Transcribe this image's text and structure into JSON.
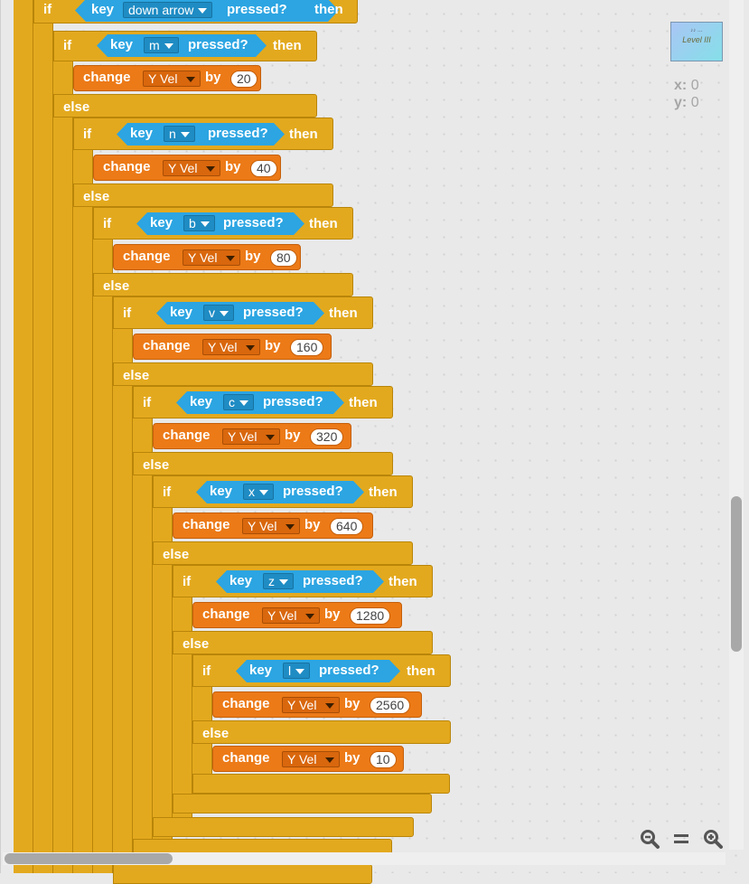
{
  "blocks": {
    "if_label": "if",
    "else_label": "else",
    "then_label": "then",
    "key_label": "key",
    "pressed_label": "pressed?",
    "change_label": "change",
    "by_label": "by",
    "variable": "Y Vel",
    "keys": [
      "down arrow",
      "m",
      "n",
      "b",
      "v",
      "c",
      "x",
      "z",
      "l"
    ],
    "values": [
      "20",
      "40",
      "80",
      "160",
      "320",
      "640",
      "1280",
      "2560",
      "10"
    ]
  },
  "stage": {
    "thumb_line1": "♪♪  …",
    "thumb_line2": "Level III",
    "x_label": "x:",
    "x_value": "0",
    "y_label": "y:",
    "y_value": "0"
  },
  "zoom": {
    "out_icon": "zoom-out-icon",
    "reset_icon": "zoom-reset-icon",
    "in_icon": "zoom-in-icon"
  },
  "colors": {
    "control": "#e3a91e",
    "sensing": "#2ca5e2",
    "data": "#ec7a17"
  }
}
